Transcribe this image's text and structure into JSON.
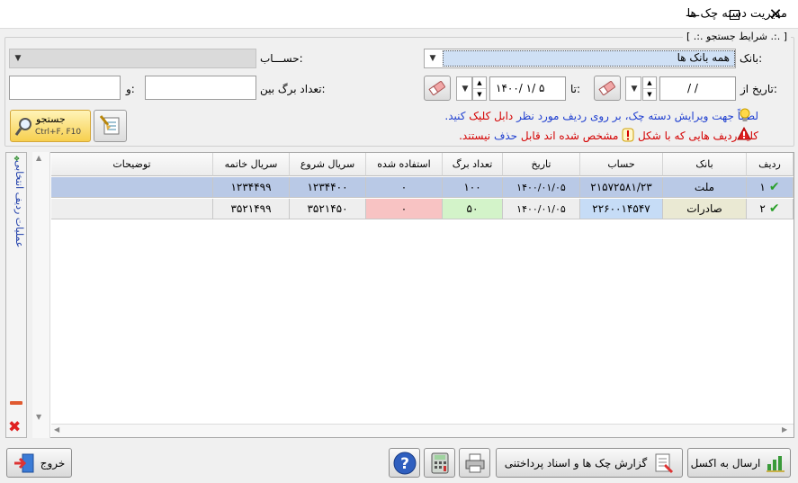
{
  "window": {
    "title": "مدیریت دسته چک ها"
  },
  "search": {
    "legend": "[ .:. شرایط جستجو .:. ]",
    "bank_label": "بانک:",
    "bank_value": "همه بانک ها",
    "account_label": "حســـاب:",
    "account_value": "",
    "date_from_label": "تاریخ از:",
    "date_from_value": "/     /",
    "date_to_label": "تا:",
    "date_to_value": "۱۴۰۰/ ۱/ ۵",
    "leaf_count_label": "تعداد برگ بین:",
    "and_label": "و:",
    "leaf_from_value": "",
    "leaf_to_value": "",
    "search_btn_label": "جستجو",
    "search_btn_shortcut": "Ctrl+F, F10",
    "hint1_prefix": "لطفاً جهت ویرایش دسته چک، بر روی ردیف مورد نظر",
    "hint1_highlight": "دابل کلیک",
    "hint1_suffix": "کنید.",
    "hint2_prefix": "کلیه ردیف هایی که با شکل",
    "hint2_middle": "مشخص شده اند قابل",
    "hint2_highlight": "حذف",
    "hint2_suffix": "نیستند."
  },
  "side_panel": {
    "label": "عملیات ردیف انتخابی"
  },
  "grid": {
    "columns": [
      "ردیف",
      "بانک",
      "حساب",
      "تاریخ",
      "تعداد برگ",
      "استفاده شده",
      "سریال شروع",
      "سریال خاتمه",
      "توضیحات"
    ],
    "rows": [
      {
        "row": "۱",
        "bank": "ملت",
        "account": "۲۱۵۷۲۵۸۱/۲۳",
        "date": "۱۴۰۰/۰۱/۰۵",
        "leaves": "۱۰۰",
        "used": "۰",
        "serial_start": "۱۲۳۴۴۰۰",
        "serial_end": "۱۲۳۴۴۹۹",
        "notes": ""
      },
      {
        "row": "۲",
        "bank": "صادرات",
        "account": "۲۲۶۰۰۱۴۵۴۷",
        "date": "۱۴۰۰/۰۱/۰۵",
        "leaves": "۵۰",
        "used": "۰",
        "serial_start": "۳۵۲۱۴۵۰",
        "serial_end": "۳۵۲۱۴۹۹",
        "notes": ""
      }
    ]
  },
  "footer": {
    "excel_label": "ارسال به اکسل",
    "report_label": "گزارش چک ها و اسناد پرداختنی",
    "exit_label": "خروج"
  },
  "colors": {
    "selected_row": "#b9c9e6",
    "bank_cell_row2": "#eae9d3",
    "account_cell_row2": "#c6dcf6",
    "used_cell_row2": "#f8c3c3",
    "leaves_cell_row2": "#d3f3c9",
    "hint_blue": "#1f3fd0",
    "hint_red": "#d40000"
  }
}
